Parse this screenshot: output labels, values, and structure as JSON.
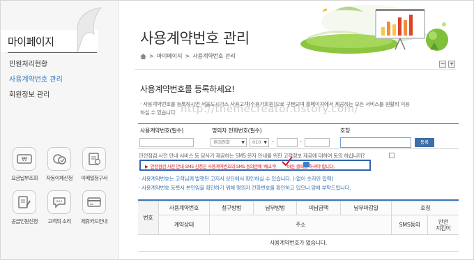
{
  "sidebar": {
    "title": "마이페이지",
    "menu": [
      "민원처리현황",
      "사용계약번호 관리",
      "회원정보 관리"
    ],
    "quick": [
      "요금납부조회",
      "자동이체신청",
      "이메일청구서",
      "공급인원신청",
      "고객의 소리",
      "제휴카드안내"
    ]
  },
  "header": {
    "title": "사용계약번호 관리",
    "breadcrumb": [
      "마이페이지",
      "사용계약번호 관리"
    ],
    "zoom_out": "−",
    "zoom_in": "+"
  },
  "section": {
    "title": "사용계약번호를 등록하세요!",
    "note_line1": "· 사용계약번호를 등록하시면 서울도시가스 사용고객(수용가회원)으로 구분되며 홈페이지에서 제공하는 모든 서비스를 원활히 이용",
    "note_line2": "  하실 수 있습니다."
  },
  "watermark": "http://themecreator.tistory.com/",
  "form": {
    "contract_label": "사용계약번호(필수)",
    "phone_label": "명의자 전화번호(필수)",
    "nickname_label": "호칭",
    "phone_type": "휴대전화",
    "phone_prefix": "010",
    "confirm_button": "등록",
    "consent": "안전점검 사전 안내 서비스 등 당사가 제공하는 SMS 문자 안내를 위한 고객정보 제공에 대하여 동의 하십니까?",
    "alert": "안전점검 사전 안내 SMS 신청은 사용계약번호의 SMS 동의란에 '체크'후",
    "alert_tail": "버튼 클릭을 하셔야 합니다."
  },
  "info": [
    "· 사용계약번호는 고객님께 발행된 고지서 상단에서 확인하실 수 있습니다. (-없이 숫자만 입력)",
    "· 사용계약번호 등록시 본인임을 확인하기 위해 명의자 전화번호를 확인하고 있으니 양해 부탁드립니다."
  ],
  "table": {
    "col_no": "번호",
    "header_row1": [
      "사용계약번호",
      "청구방법",
      "납부방법",
      "미납금액",
      "납부마감일",
      "호칭"
    ],
    "header_row2": [
      "계약상태",
      "주소",
      "SMS동의",
      "안전\n지킴이"
    ],
    "empty": "사용계약번호가 없습니다."
  },
  "colors": {
    "accent": "#3b78b8",
    "alert": "#d0202a",
    "info": "#3d79b7"
  }
}
